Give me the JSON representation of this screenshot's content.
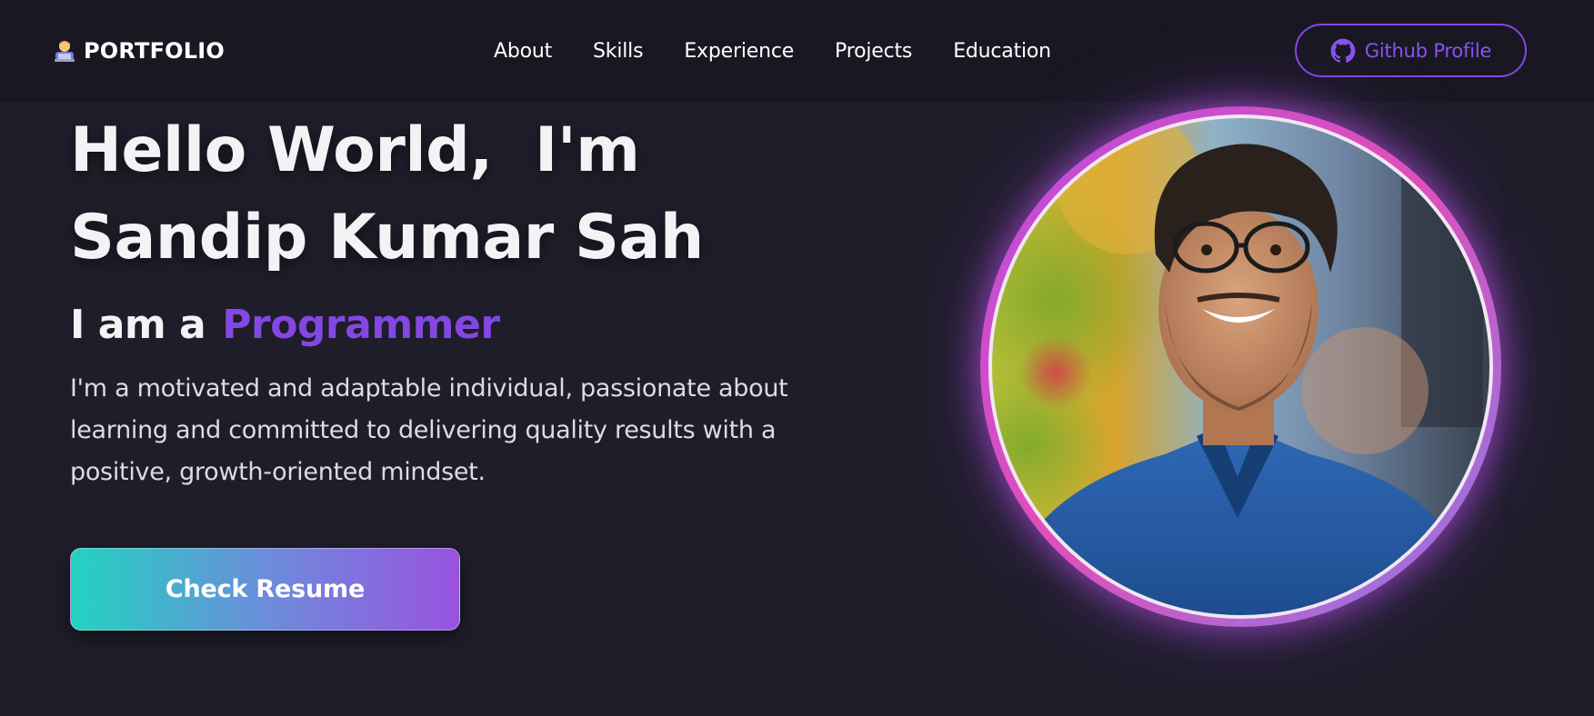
{
  "brand": {
    "icon": "technologist-emoji-icon",
    "text": "PORTFOLIO"
  },
  "nav": {
    "links": [
      "About",
      "Skills",
      "Experience",
      "Projects",
      "Education"
    ]
  },
  "github": {
    "icon": "github-icon",
    "label": "Github Profile"
  },
  "hero": {
    "line1": "Hello World,  I'm",
    "line2": "Sandip Kumar Sah",
    "role_prefix": "I am a",
    "role_value": "Programmer",
    "bio": "I'm a motivated and adaptable individual, passionate about learning and committed to delivering quality results with a positive, growth-oriented mindset.",
    "resume_label": "Check Resume"
  },
  "colors": {
    "background": "#1e1d29",
    "navbar": "#191822",
    "accent": "#8447e3",
    "button_gradient_start": "#22d3c0",
    "button_gradient_end": "#9a52e0",
    "ring_glow": "#e04fb8"
  }
}
